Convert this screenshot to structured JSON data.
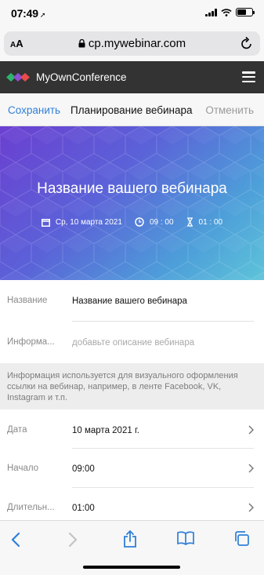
{
  "status_bar": {
    "time": "07:49",
    "location_icon": "location-arrow-icon"
  },
  "browser": {
    "aa_small": "A",
    "aa_big": "A",
    "url": "cp.mywebinar.com",
    "lock_icon": "lock-icon",
    "reload_icon": "reload-icon"
  },
  "site_header": {
    "title": "MyOwnConference",
    "menu_icon": "hamburger-menu-icon"
  },
  "toolbar": {
    "save_label": "Сохранить",
    "title": "Планирование вебинара",
    "cancel_label": "Отменить"
  },
  "banner": {
    "title": "Название вашего вебинара",
    "date": "Ср, 10 марта 2021",
    "time": "09 : 00",
    "duration": "01 : 00"
  },
  "form": {
    "name_label": "Название",
    "name_value": "Название вашего вебинара",
    "info_label": "Информа...",
    "info_placeholder": "добавьте описание вебинара",
    "info_hint": "Информация используется для визуального оформления ссылки на вебинар, например, в ленте Facebook, VK, Instagram и т.п.",
    "date_label": "Дата",
    "date_value": "10 марта 2021 г.",
    "start_label": "Начало",
    "start_value": "09:00",
    "duration_label": "Длительн...",
    "duration_value": "01:00"
  },
  "colors": {
    "accent": "#2f7fd8",
    "header_bg": "#333333",
    "banner_start": "#6b3fd1",
    "banner_end": "#5ec4d9"
  }
}
